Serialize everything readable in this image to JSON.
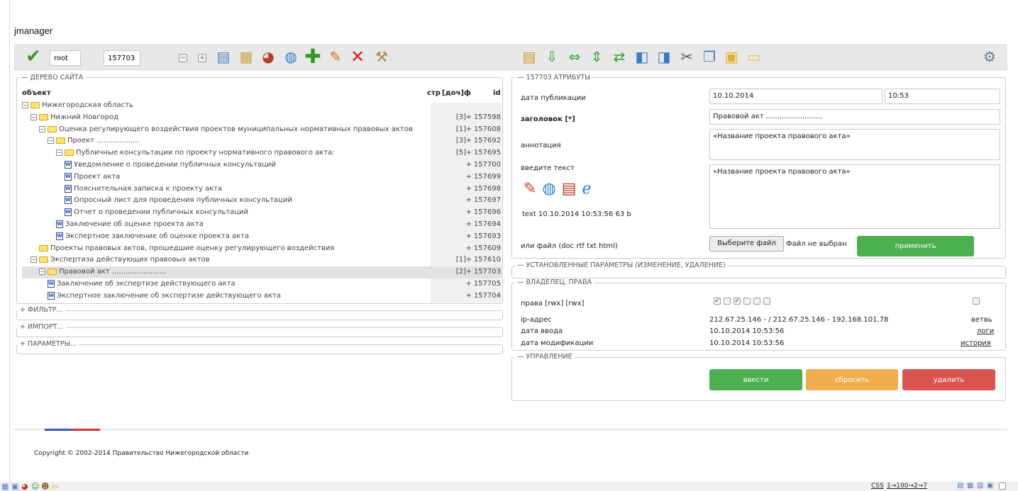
{
  "app_title": "jmanager",
  "toolbar": {
    "user_value": "root",
    "id_value": "157703",
    "left_icons": [
      "check-icon",
      "minus-box-icon",
      "plus-box-icon",
      "page-icon",
      "page-list-icon",
      "pie-chart-icon",
      "globe-page-icon",
      "add-icon",
      "pencil-icon",
      "delete-icon",
      "tools-icon"
    ],
    "right_icons": [
      "chart-page-icon",
      "move-down-icon",
      "move-left-right-icon",
      "move-up-down-icon",
      "swap-icon",
      "export-page-icon",
      "import-page-icon",
      "scissors-icon",
      "copy-icon",
      "paste-icon",
      "clipboard-icon",
      "settings-window-icon"
    ]
  },
  "tree": {
    "legend": "— ДЕРЕВО САЙТА",
    "col_object": "объект",
    "col_pages": "стр",
    "col_children": "[доч]",
    "col_f": "ф",
    "col_id": "id",
    "rows": [
      {
        "name": "Нижегородская область",
        "count": "",
        "plus": "",
        "id": ""
      },
      {
        "name": "Нижний Новгород",
        "count": "[3]",
        "plus": "+",
        "id": "157598"
      },
      {
        "name": "Оценка регулирующего воздействия проектов муниципальных нормативных правовых актов",
        "count": "[1]",
        "plus": "+",
        "id": "157608"
      },
      {
        "name": "Проект ...................",
        "count": "[3]",
        "plus": "+",
        "id": "157692"
      },
      {
        "name": "Публичные консультации по проекту нормативного правового акта:",
        "count": "[5]",
        "plus": "+",
        "id": "157695"
      },
      {
        "name": "Уведомление о проведении публичных консультаций",
        "count": "",
        "plus": "+",
        "id": "157700"
      },
      {
        "name": "Проект акта",
        "count": "",
        "plus": "+",
        "id": "157699"
      },
      {
        "name": "Пояснительная записка к проекту акта",
        "count": "",
        "plus": "+",
        "id": "157698"
      },
      {
        "name": "Опросный лист для проведения публичных консультаций",
        "count": "",
        "plus": "+",
        "id": "157697"
      },
      {
        "name": "Отчет о проведении публичных консультаций",
        "count": "",
        "plus": "+",
        "id": "157696"
      },
      {
        "name": "Заключение об оценке проекта акта",
        "count": "",
        "plus": "+",
        "id": "157694"
      },
      {
        "name": "Экспертное заключение об оценке проекта акта",
        "count": "",
        "plus": "+",
        "id": "157693"
      },
      {
        "name": "Проекты правовых актов, прошедшие оценку регулирующего воздействия",
        "count": "",
        "plus": "+",
        "id": "157609"
      },
      {
        "name": "Экспертиза действующих правовых актов",
        "count": "[1]",
        "plus": "+",
        "id": "157610"
      },
      {
        "name": "Правовой акт ........................",
        "count": "[2]",
        "plus": "+",
        "id": "157703"
      },
      {
        "name": "Заключение об экспертизе действующего акта",
        "count": "",
        "plus": "+",
        "id": "157705"
      },
      {
        "name": "Экспертное заключение об экспертизе действующего акта",
        "count": "",
        "plus": "+",
        "id": "157704"
      }
    ]
  },
  "filter_legend": "+ ФИЛЬТР...",
  "import_legend": "+ ИМПОРТ...",
  "params_legend": "+ ПАРАМЕТРЫ...",
  "attrs": {
    "legend": "— 157703 АТРИБУТЫ",
    "pub_date_label": "дата публикации",
    "pub_date": "10.10.2014",
    "pub_time": "10:53",
    "title_label": "заголовок [*]",
    "title_value": "Правовой акт .........................",
    "annotation_label": "аннотация",
    "annotation_value": "«Название проекта правового акта»",
    "text_label": "введите текст",
    "text_value": "«Название проекта правового акта»",
    "text_info": "text 10.10.2014 10:53:56 63 b",
    "file_label": "или файл (doc rtf txt html)",
    "file_button": "Выберите файл",
    "file_status": "Файл не выбран",
    "apply_button": "применить"
  },
  "installed_params_legend": "— УСТАНОВЛЕННЫЕ ПАРАМЕТРЫ (ИЗМЕНЕНИЕ, УДАЛЕНИЕ)",
  "owner": {
    "legend": "— ВЛАДЕЛЕЦ, ПРАВА",
    "rights_label": "права [rwx] [rwx]",
    "ip_label": "ip-адрес",
    "ip_value": "212.67.25.146 - / 212.67.25.146 - 192.168.101.78",
    "ip_link": "ветвь",
    "date_in_label": "дата ввода",
    "date_in_value": "10.10.2014 10:53:56",
    "date_in_link": "логи",
    "date_mod_label": "дата модификации",
    "date_mod_value": "10.10.2014 10:53:56",
    "date_mod_link": "история"
  },
  "control": {
    "legend": "— УПРАВЛЕНИЕ",
    "enter_button": "ввести",
    "reset_button": "сбросить",
    "delete_button": "удалить"
  },
  "colors": {
    "green": "#4caf50",
    "orange": "#f0ad4e",
    "red": "#d9534f"
  },
  "copyright": "Copyright © 2002-2014 Правительство Нижегородской области",
  "bottom": {
    "css_link": "CSS",
    "pages_link": "1→100→2→7"
  }
}
